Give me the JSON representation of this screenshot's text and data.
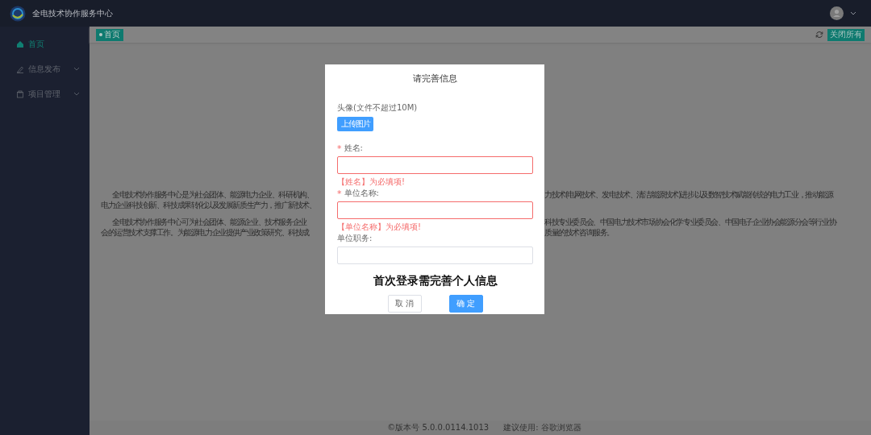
{
  "header": {
    "title": "全电技术协作服务中心"
  },
  "sidebar": {
    "items": [
      {
        "label": "首页",
        "selected": true,
        "kind": "link"
      },
      {
        "label": "信息发布",
        "selected": false,
        "kind": "submenu"
      },
      {
        "label": "项目管理",
        "selected": false,
        "kind": "submenu"
      }
    ]
  },
  "tabs": [
    {
      "label": "首页",
      "selected": true
    }
  ],
  "close_all_button": "关闭所有",
  "content": {
    "paragraphs": [
      {
        "lines": [
          {
            "left": "全电技术协作服务中心是为社会团体、能源电力企业、科研机构、",
            "right": "力技术(电网技术、发电技术、清洁能源技术)进步以及数智技术赋能传统的电力工业，推动能源"
          },
          {
            "left": "电力企业科技创新、科技成果转化以及发展新质生产力，推广新技术、"
          }
        ]
      },
      {
        "lines": [
          {
            "left": "全电技术协作服务中心可为社会团体、能源企业、技术服务企业",
            "right": "科技专业委员会、中国电力技术市场协会化学专业委员会、中国电子企业协会能源分会等行业协"
          },
          {
            "left": "会的运营技术支撑工作。为能源电力企业提供产业政策研究、科技成",
            "right": "质量的技术咨询服务。"
          }
        ]
      }
    ]
  },
  "dialog": {
    "title": "请完善信息",
    "avatar_label": "头像(文件不超过10M)",
    "upload_button": "上传图片",
    "fields": [
      {
        "required_mark": "*",
        "label": "姓名:",
        "error": "【姓名】为必填项!"
      },
      {
        "required_mark": "*",
        "label": "单位名称:",
        "error": "【单位名称】为必填项!"
      },
      {
        "label": "单位职务:"
      }
    ],
    "notice": "首次登录需完善个人信息",
    "buttons": [
      {
        "label": "取 消",
        "kind": "default"
      },
      {
        "label": "确 定",
        "kind": "primary"
      }
    ]
  },
  "footer": {
    "version": "©版本号 5.0.0.0114.1013",
    "browser_hint": "建议使用:  谷歌浏览器"
  }
}
